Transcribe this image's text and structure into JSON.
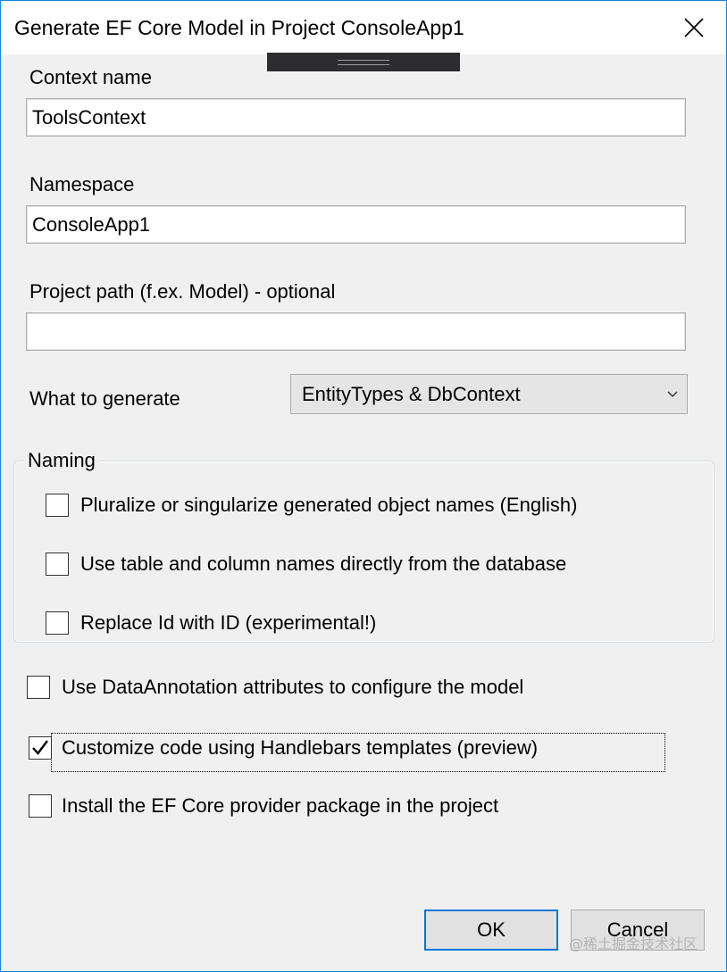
{
  "window": {
    "title": "Generate EF Core Model in Project ConsoleApp1",
    "close_icon": "close-icon"
  },
  "form": {
    "context_name": {
      "label": "Context name",
      "value": "ToolsContext"
    },
    "namespace": {
      "label": "Namespace",
      "value": "ConsoleApp1"
    },
    "project_path": {
      "label": "Project path (f.ex. Model) - optional",
      "value": ""
    },
    "what_to_generate": {
      "label": "What to generate",
      "selected": "EntityTypes & DbContext"
    }
  },
  "naming": {
    "legend": "Naming",
    "options": [
      {
        "label": "Pluralize or singularize generated object names (English)",
        "checked": false
      },
      {
        "label": "Use table and column names directly from the database",
        "checked": false
      },
      {
        "label": "Replace Id with ID (experimental!)",
        "checked": false
      }
    ]
  },
  "options": [
    {
      "label": "Use DataAnnotation attributes to configure the model",
      "checked": false
    },
    {
      "label": "Customize code using Handlebars templates (preview)",
      "checked": true
    },
    {
      "label": "Install the EF Core provider package in the project",
      "checked": false
    }
  ],
  "buttons": {
    "ok": "OK",
    "cancel": "Cancel"
  },
  "watermark": "@稀土掘金技术社区",
  "colors": {
    "accent": "#0078d7",
    "window_border": "#1883d7"
  }
}
